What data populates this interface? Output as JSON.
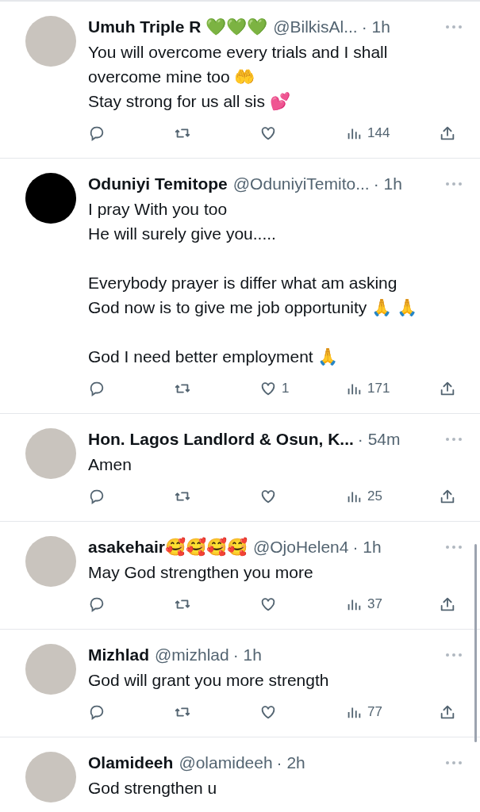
{
  "tweets": [
    {
      "avatar": {
        "kind": "photo"
      },
      "name": "Umuh Triple R 💚💚💚",
      "handle": "@BilkisAl...",
      "time": "· 1h",
      "text": "You will overcome every trials and I shall overcome mine too 🤲\nStay strong for us all sis 💕",
      "views": "144"
    },
    {
      "avatar": {
        "kind": "dark"
      },
      "name": "Oduniyi Temitope",
      "handle": "@OduniyiTemito...",
      "time": "· 1h",
      "text": "I pray With you too\nHe will surely give you.....\n\nEverybody prayer is differ what am asking God now is to give me job opportunity 🙏 🙏\n\nGod I need better employment 🙏",
      "likes": "1",
      "views": "171"
    },
    {
      "avatar": {
        "kind": "photo"
      },
      "name": "Hon. Lagos Landlord & Osun, K...",
      "time": "· 54m",
      "text": "Amen",
      "views": "25"
    },
    {
      "avatar": {
        "kind": "photo"
      },
      "name": "asakehair🥰🥰🥰🥰",
      "handle": "@OjoHelen4",
      "time": "· 1h",
      "text": "May God strengthen you more",
      "views": "37"
    },
    {
      "avatar": {
        "kind": "photo"
      },
      "name": "Mizhlad",
      "handle": "@mizhlad",
      "time": "· 1h",
      "text": "God will grant you more strength",
      "views": "77"
    },
    {
      "avatar": {
        "kind": "photo"
      },
      "name": "Olamideeh",
      "handle": "@olamideeh",
      "time": "· 2h",
      "text": "God strengthen u"
    }
  ]
}
